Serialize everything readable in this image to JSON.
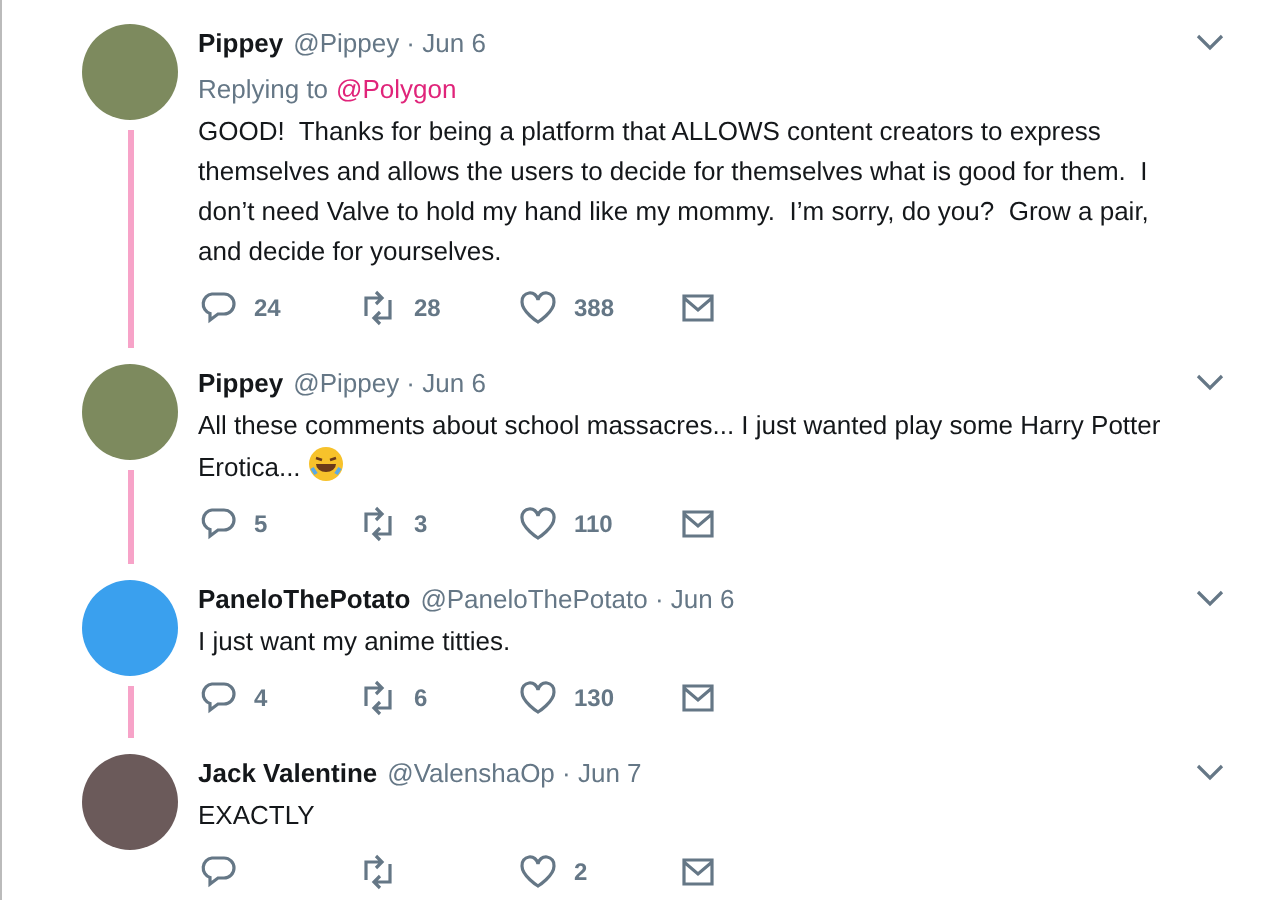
{
  "tweets": [
    {
      "name": "Pippey",
      "handle_date": "@Pippey · Jun 6",
      "replying_label": "Replying to",
      "replying_to": "@Polygon",
      "body": "GOOD!  Thanks for being a platform that ALLOWS content creators to express themselves and allows the users to decide for themselves what is good for them.  I don’t need Valve to hold my hand like my mommy.  I’m sorry, do you?  Grow a pair, and decide for yourselves.",
      "emoji": false,
      "color": "#7d8a5e",
      "thread_line": true,
      "replies": "24",
      "retweets": "28",
      "likes": "388"
    },
    {
      "name": "Pippey",
      "handle_date": "@Pippey · Jun 6",
      "body": "All these comments about school massacres... I just wanted play some Harry Potter Erotica...",
      "emoji": true,
      "color": "#7d8a5e",
      "thread_line": true,
      "replies": "5",
      "retweets": "3",
      "likes": "110"
    },
    {
      "name": "PaneloThePotato",
      "handle_date": "@PaneloThePotato · Jun 6",
      "body": "I just want my anime titties.",
      "emoji": false,
      "color": "#3aa0ee",
      "thread_line": true,
      "replies": "4",
      "retweets": "6",
      "likes": "130"
    },
    {
      "name": "Jack Valentine",
      "handle_date": "@ValenshaOp · Jun 7",
      "body": "EXACTLY",
      "emoji": false,
      "color": "#6b5a5a",
      "thread_line": false,
      "likes": "2"
    }
  ]
}
